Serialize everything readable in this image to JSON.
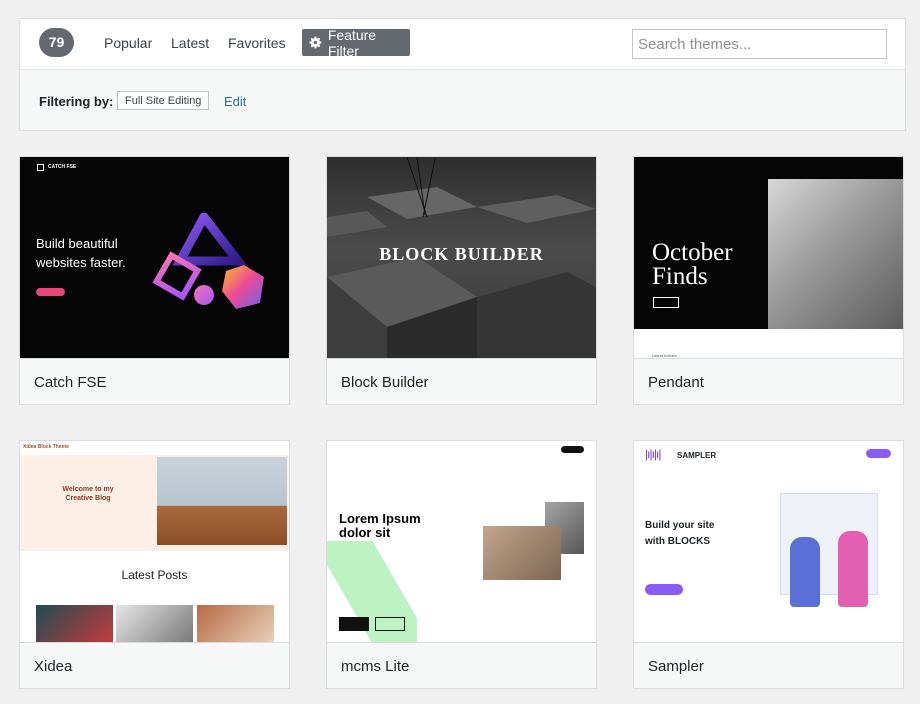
{
  "header": {
    "theme_count": "79",
    "nav": [
      {
        "label": "Popular"
      },
      {
        "label": "Latest"
      },
      {
        "label": "Favorites"
      }
    ],
    "feature_filter_label": "Feature Filter",
    "search_placeholder": "Search themes..."
  },
  "filtering": {
    "label": "Filtering by:",
    "tag": "Full Site Editing",
    "edit_label": "Edit"
  },
  "themes": [
    {
      "name": "Catch FSE",
      "preview": {
        "logo": "CATCH FSE",
        "headline_1": "Build beautiful",
        "headline_2": "websites faster."
      }
    },
    {
      "name": "Block Builder",
      "preview": {
        "title": "BLOCK BUILDER"
      }
    },
    {
      "name": "Pendant",
      "preview": {
        "headline_1": "October",
        "headline_2": "Finds",
        "latest": "Latest Articles"
      }
    },
    {
      "name": "Xidea",
      "preview": {
        "brand": "Xidea Block Theme",
        "welcome_1": "Welcome to my",
        "welcome_2": "Creative Blog",
        "latest": "Latest Posts"
      }
    },
    {
      "name": "mcms Lite",
      "preview": {
        "headline_1": "Lorem Ipsum",
        "headline_2": "dolor sit"
      }
    },
    {
      "name": "Sampler",
      "preview": {
        "brand": "SAMPLER",
        "headline_1": "Build your site",
        "headline_2": "with BLOCKS"
      }
    }
  ],
  "colors": {
    "accent": "#2271b1",
    "badge": "#646970",
    "background": "#f0f0f1"
  }
}
